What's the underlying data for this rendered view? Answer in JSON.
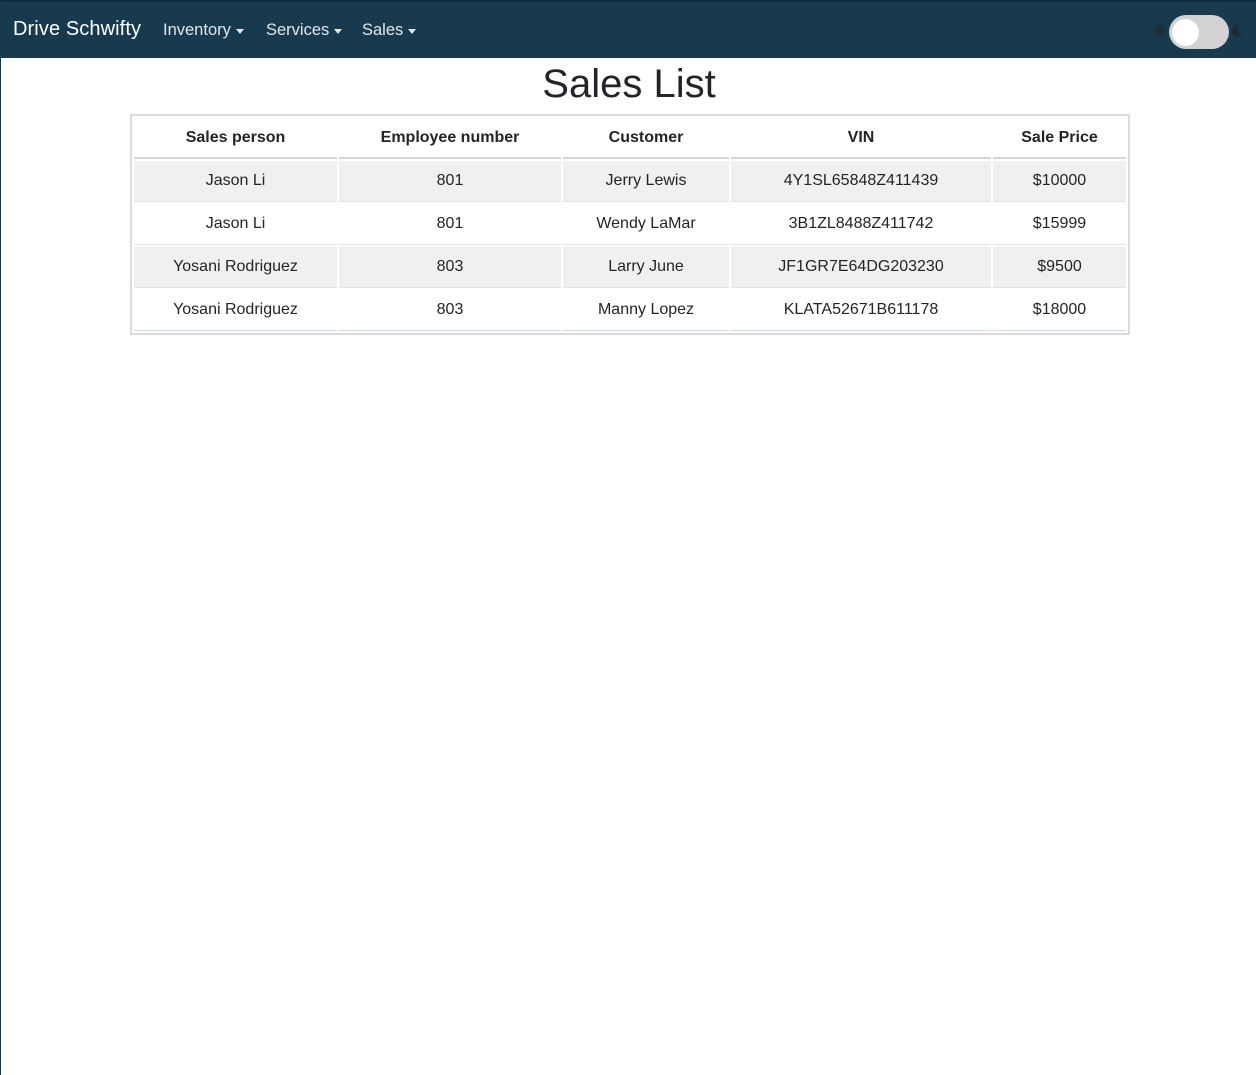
{
  "navbar": {
    "brand": "Drive Schwifty",
    "items": [
      {
        "label": "Inventory"
      },
      {
        "label": "Services"
      },
      {
        "label": "Sales"
      }
    ],
    "theme_toggle": {
      "left_icon": "sun-icon",
      "right_icon": "moon-icon",
      "dark_mode": false
    }
  },
  "main": {
    "title": "Sales List",
    "table": {
      "columns": [
        "Sales person",
        "Employee number",
        "Customer",
        "VIN",
        "Sale Price"
      ],
      "rows": [
        [
          "Jason Li",
          "801",
          "Jerry Lewis",
          "4Y1SL65848Z411439",
          "$10000"
        ],
        [
          "Jason Li",
          "801",
          "Wendy LaMar",
          "3B1ZL8488Z411742",
          "$15999"
        ],
        [
          "Yosani Rodriguez",
          "803",
          "Larry June",
          "JF1GR7E64DG203230",
          "$9500"
        ],
        [
          "Yosani Rodriguez",
          "803",
          "Manny Lopez",
          "KLATA52671B611178",
          "$18000"
        ]
      ]
    }
  },
  "colors": {
    "navbar_bg": "#173a4f",
    "striped_row": "#f0f0f0"
  }
}
